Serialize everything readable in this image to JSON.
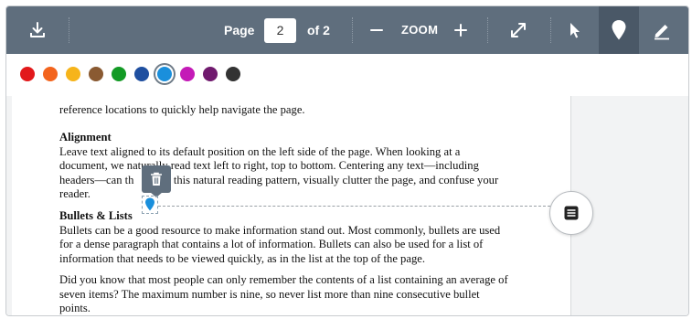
{
  "toolbar": {
    "download_icon": "download-icon",
    "page_label": "Page",
    "page_value": "2",
    "page_total": "of 2",
    "zoom_label": "ZOOM",
    "zoom_out_icon": "minus-icon",
    "zoom_in_icon": "plus-icon",
    "fullscreen_icon": "expand-icon",
    "select_icon": "cursor-icon",
    "pin_icon": "pin-icon",
    "draw_icon": "pencil-icon"
  },
  "colors": [
    {
      "name": "red",
      "hex": "#e2191b"
    },
    {
      "name": "orange",
      "hex": "#f3641d"
    },
    {
      "name": "yellow",
      "hex": "#f6b41a"
    },
    {
      "name": "brown",
      "hex": "#8a5a32"
    },
    {
      "name": "green",
      "hex": "#139a25"
    },
    {
      "name": "navy",
      "hex": "#1f4fa0"
    },
    {
      "name": "blue",
      "hex": "#1a8fdc",
      "selected": true
    },
    {
      "name": "magenta",
      "hex": "#c41ab7"
    },
    {
      "name": "purple",
      "hex": "#701a6e"
    },
    {
      "name": "black",
      "hex": "#333333"
    }
  ],
  "document": {
    "line0": "reference locations to quickly help navigate the page.",
    "h_alignment": "Alignment",
    "p_alignment_1": "Leave text aligned to its default position on the left side of the page. When looking at a",
    "p_alignment_2": "document, we naturally read text left to right, top to bottom. Centering any text—including",
    "p_alignment_3a": "headers—can th",
    "p_alignment_3b": "f this natural reading pattern, visually clutter the page, and confuse your",
    "p_alignment_4": "reader.",
    "h_bullets": "Bullets & Lists",
    "p_bullets_1": "Bullets can be a good resource to make information stand out. Most commonly, bullets are used",
    "p_bullets_2": "for a dense paragraph that contains a lot of information. Bullets can also be used for a list of",
    "p_bullets_3": "information that needs to be viewed quickly, as in the list at the top of the page.",
    "p_memory_1": "Did you know that most people can only remember the contents of a list containing an average of",
    "p_memory_2": "seven items? The maximum number is nine, so never list more than nine consecutive bullet",
    "p_memory_3": "points."
  },
  "annotation": {
    "delete_icon": "trash-icon",
    "marker_icon": "pin-marker-icon",
    "comment_icon": "comment-icon",
    "marker_color": "#1a8fdc"
  }
}
